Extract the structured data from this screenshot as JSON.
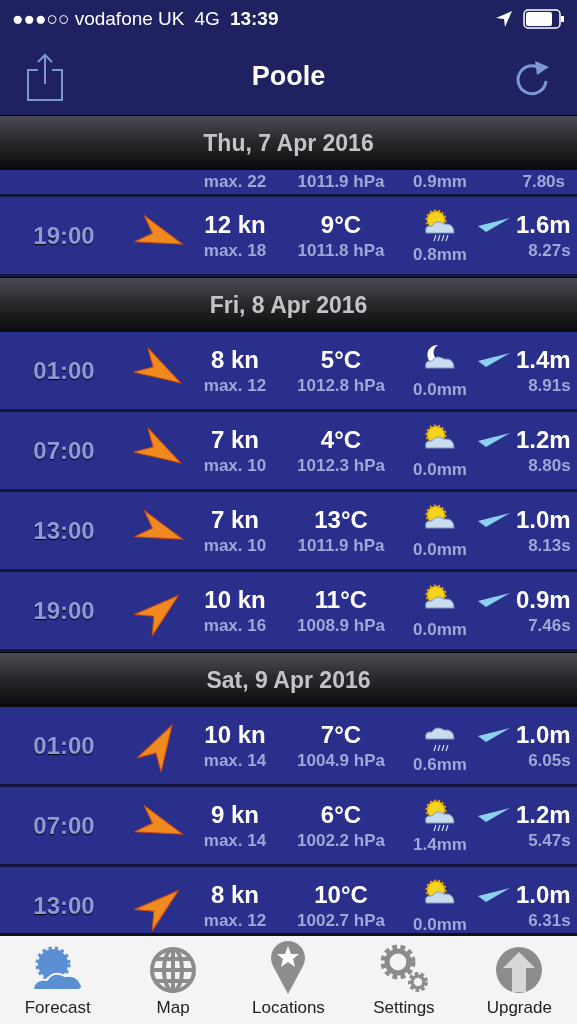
{
  "status_bar": {
    "carrier": "●●●○○ vodafone UK",
    "network": "4G",
    "time": "13:39"
  },
  "nav": {
    "title": "Poole"
  },
  "days": [
    {
      "date": "Thu, 7 Apr 2016",
      "partial_row": {
        "wind_max": "max. 22",
        "pressure": "1011.9 hPa",
        "rain": "0.9mm",
        "period": "7.80s"
      },
      "rows": [
        {
          "time": "19:00",
          "wind_arrow": {
            "kind": "ese"
          },
          "wind": "12 kn",
          "wind_max": "max. 18",
          "temp": "9°C",
          "pressure": "1011.8 hPa",
          "weather_icon": {
            "kind": "sunraincloud"
          },
          "rain": "0.8mm",
          "wave": "1.6m",
          "period": "8.27s"
        }
      ]
    },
    {
      "date": "Fri, 8 Apr 2016",
      "rows": [
        {
          "time": "01:00",
          "wind_arrow": {
            "kind": "se"
          },
          "wind": "8 kn",
          "wind_max": "max. 12",
          "temp": "5°C",
          "pressure": "1012.8 hPa",
          "weather_icon": {
            "kind": "mooncloud"
          },
          "rain": "0.0mm",
          "wave": "1.4m",
          "period": "8.91s"
        },
        {
          "time": "07:00",
          "wind_arrow": {
            "kind": "se"
          },
          "wind": "7 kn",
          "wind_max": "max. 10",
          "temp": "4°C",
          "pressure": "1012.3 hPa",
          "weather_icon": {
            "kind": "suncloud"
          },
          "rain": "0.0mm",
          "wave": "1.2m",
          "period": "8.80s"
        },
        {
          "time": "13:00",
          "wind_arrow": {
            "kind": "ese"
          },
          "wind": "7 kn",
          "wind_max": "max. 10",
          "temp": "13°C",
          "pressure": "1011.9 hPa",
          "weather_icon": {
            "kind": "suncloud"
          },
          "rain": "0.0mm",
          "wave": "1.0m",
          "period": "8.13s"
        },
        {
          "time": "19:00",
          "wind_arrow": {
            "kind": "ne"
          },
          "wind": "10 kn",
          "wind_max": "max. 16",
          "temp": "11°C",
          "pressure": "1008.9 hPa",
          "weather_icon": {
            "kind": "suncloud"
          },
          "rain": "0.0mm",
          "wave": "0.9m",
          "period": "7.46s"
        }
      ]
    },
    {
      "date": "Sat, 9 Apr 2016",
      "rows": [
        {
          "time": "01:00",
          "wind_arrow": {
            "kind": "nne"
          },
          "wind": "10 kn",
          "wind_max": "max. 14",
          "temp": "7°C",
          "pressure": "1004.9 hPa",
          "weather_icon": {
            "kind": "raincloud"
          },
          "rain": "0.6mm",
          "wave": "1.0m",
          "period": "6.05s"
        },
        {
          "time": "07:00",
          "wind_arrow": {
            "kind": "ese"
          },
          "wind": "9 kn",
          "wind_max": "max. 14",
          "temp": "6°C",
          "pressure": "1002.2 hPa",
          "weather_icon": {
            "kind": "sunraincloud"
          },
          "rain": "1.4mm",
          "wave": "1.2m",
          "period": "5.47s"
        },
        {
          "time": "13:00",
          "wind_arrow": {
            "kind": "ne"
          },
          "wind": "8 kn",
          "wind_max": "max. 12",
          "temp": "10°C",
          "pressure": "1002.7 hPa",
          "weather_icon": {
            "kind": "suncloud"
          },
          "rain": "0.0mm",
          "wave": "1.0m",
          "period": "6.31s"
        }
      ]
    }
  ],
  "tabs": [
    {
      "kind": "forecast",
      "label": "Forecast",
      "selected": true
    },
    {
      "kind": "map",
      "label": "Map",
      "selected": false
    },
    {
      "kind": "locations",
      "label": "Locations",
      "selected": false
    },
    {
      "kind": "settings",
      "label": "Settings",
      "selected": false
    },
    {
      "kind": "upgrade",
      "label": "Upgrade",
      "selected": false
    }
  ]
}
